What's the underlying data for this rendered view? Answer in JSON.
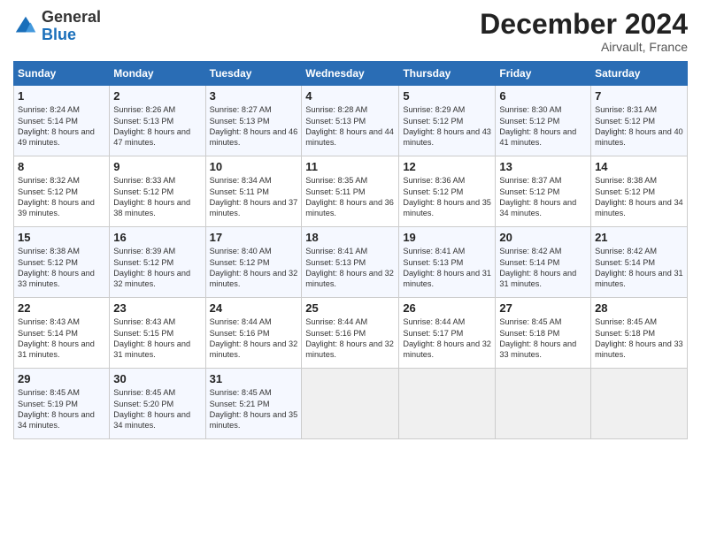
{
  "logo": {
    "general": "General",
    "blue": "Blue"
  },
  "title": "December 2024",
  "location": "Airvault, France",
  "days_header": [
    "Sunday",
    "Monday",
    "Tuesday",
    "Wednesday",
    "Thursday",
    "Friday",
    "Saturday"
  ],
  "weeks": [
    [
      {
        "day": "1",
        "sunrise": "8:24 AM",
        "sunset": "5:14 PM",
        "daylight": "8 hours and 49 minutes."
      },
      {
        "day": "2",
        "sunrise": "8:26 AM",
        "sunset": "5:13 PM",
        "daylight": "8 hours and 47 minutes."
      },
      {
        "day": "3",
        "sunrise": "8:27 AM",
        "sunset": "5:13 PM",
        "daylight": "8 hours and 46 minutes."
      },
      {
        "day": "4",
        "sunrise": "8:28 AM",
        "sunset": "5:13 PM",
        "daylight": "8 hours and 44 minutes."
      },
      {
        "day": "5",
        "sunrise": "8:29 AM",
        "sunset": "5:12 PM",
        "daylight": "8 hours and 43 minutes."
      },
      {
        "day": "6",
        "sunrise": "8:30 AM",
        "sunset": "5:12 PM",
        "daylight": "8 hours and 41 minutes."
      },
      {
        "day": "7",
        "sunrise": "8:31 AM",
        "sunset": "5:12 PM",
        "daylight": "8 hours and 40 minutes."
      }
    ],
    [
      {
        "day": "8",
        "sunrise": "8:32 AM",
        "sunset": "5:12 PM",
        "daylight": "8 hours and 39 minutes."
      },
      {
        "day": "9",
        "sunrise": "8:33 AM",
        "sunset": "5:12 PM",
        "daylight": "8 hours and 38 minutes."
      },
      {
        "day": "10",
        "sunrise": "8:34 AM",
        "sunset": "5:11 PM",
        "daylight": "8 hours and 37 minutes."
      },
      {
        "day": "11",
        "sunrise": "8:35 AM",
        "sunset": "5:11 PM",
        "daylight": "8 hours and 36 minutes."
      },
      {
        "day": "12",
        "sunrise": "8:36 AM",
        "sunset": "5:12 PM",
        "daylight": "8 hours and 35 minutes."
      },
      {
        "day": "13",
        "sunrise": "8:37 AM",
        "sunset": "5:12 PM",
        "daylight": "8 hours and 34 minutes."
      },
      {
        "day": "14",
        "sunrise": "8:38 AM",
        "sunset": "5:12 PM",
        "daylight": "8 hours and 34 minutes."
      }
    ],
    [
      {
        "day": "15",
        "sunrise": "8:38 AM",
        "sunset": "5:12 PM",
        "daylight": "8 hours and 33 minutes."
      },
      {
        "day": "16",
        "sunrise": "8:39 AM",
        "sunset": "5:12 PM",
        "daylight": "8 hours and 32 minutes."
      },
      {
        "day": "17",
        "sunrise": "8:40 AM",
        "sunset": "5:12 PM",
        "daylight": "8 hours and 32 minutes."
      },
      {
        "day": "18",
        "sunrise": "8:41 AM",
        "sunset": "5:13 PM",
        "daylight": "8 hours and 32 minutes."
      },
      {
        "day": "19",
        "sunrise": "8:41 AM",
        "sunset": "5:13 PM",
        "daylight": "8 hours and 31 minutes."
      },
      {
        "day": "20",
        "sunrise": "8:42 AM",
        "sunset": "5:14 PM",
        "daylight": "8 hours and 31 minutes."
      },
      {
        "day": "21",
        "sunrise": "8:42 AM",
        "sunset": "5:14 PM",
        "daylight": "8 hours and 31 minutes."
      }
    ],
    [
      {
        "day": "22",
        "sunrise": "8:43 AM",
        "sunset": "5:14 PM",
        "daylight": "8 hours and 31 minutes."
      },
      {
        "day": "23",
        "sunrise": "8:43 AM",
        "sunset": "5:15 PM",
        "daylight": "8 hours and 31 minutes."
      },
      {
        "day": "24",
        "sunrise": "8:44 AM",
        "sunset": "5:16 PM",
        "daylight": "8 hours and 32 minutes."
      },
      {
        "day": "25",
        "sunrise": "8:44 AM",
        "sunset": "5:16 PM",
        "daylight": "8 hours and 32 minutes."
      },
      {
        "day": "26",
        "sunrise": "8:44 AM",
        "sunset": "5:17 PM",
        "daylight": "8 hours and 32 minutes."
      },
      {
        "day": "27",
        "sunrise": "8:45 AM",
        "sunset": "5:18 PM",
        "daylight": "8 hours and 33 minutes."
      },
      {
        "day": "28",
        "sunrise": "8:45 AM",
        "sunset": "5:18 PM",
        "daylight": "8 hours and 33 minutes."
      }
    ],
    [
      {
        "day": "29",
        "sunrise": "8:45 AM",
        "sunset": "5:19 PM",
        "daylight": "8 hours and 34 minutes."
      },
      {
        "day": "30",
        "sunrise": "8:45 AM",
        "sunset": "5:20 PM",
        "daylight": "8 hours and 34 minutes."
      },
      {
        "day": "31",
        "sunrise": "8:45 AM",
        "sunset": "5:21 PM",
        "daylight": "8 hours and 35 minutes."
      },
      null,
      null,
      null,
      null
    ]
  ]
}
